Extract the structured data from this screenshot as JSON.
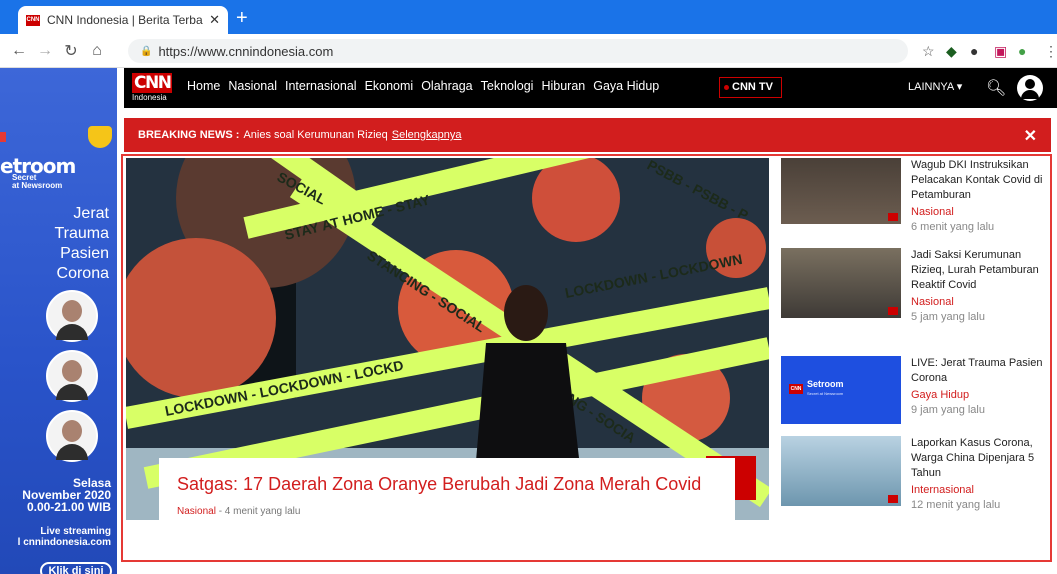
{
  "browser": {
    "tab_title": "CNN Indonesia | Berita Terbaru, T",
    "tab_favicon": "CNN",
    "url": "https://www.cnnindonesia.com"
  },
  "ad": {
    "brand": "etroom",
    "brand_sub_1": "Secret",
    "brand_sub_2": "at Newsroom",
    "headline_1": "Jerat",
    "headline_2": "Trauma",
    "headline_3": "Pasien",
    "headline_4": "Corona",
    "date_1": "Selasa",
    "date_2": "November 2020",
    "date_3": "0.00-21.00 WIB",
    "live_1": "Live streaming",
    "live_2": "l cnnindonesia.com",
    "cta": "Klik di sini"
  },
  "nav": {
    "logo": "CNN",
    "logo_sub": "Indonesia",
    "items": [
      "Home",
      "Nasional",
      "Internasional",
      "Ekonomi",
      "Olahraga",
      "Teknologi",
      "Hiburan",
      "Gaya Hidup"
    ],
    "cnntv": "CNN TV",
    "more": "LAINNYA ▾"
  },
  "breaking": {
    "label": "BREAKING NEWS :",
    "text": "Anies soal Kerumunan Rizieq",
    "link": "Selengkapnya"
  },
  "hero": {
    "headline": "Satgas: 17 Daerah Zona Oranye Berubah Jadi Zona Merah Covid",
    "category": "Nasional",
    "time": "- 4 menit yang lalu",
    "tape_1": "SOCIAL",
    "tape_2": "STAY AT HOME - STAY",
    "tape_3": "LOCKDOWN - LOCKDOWN",
    "tape_4": "LOCKDOWN - LOCKDOWN - LOCKD",
    "tape_5": "PSBB - PSBB - P",
    "tape_6": "STANCING - SOCIAL",
    "tape_7": "NCING - SOCIA"
  },
  "sidebar": [
    {
      "title": "Wagub DKI Instruksikan Pelacakan Kontak Covid di Petamburan",
      "category": "Nasional",
      "time": "6 menit yang lalu"
    },
    {
      "title": "Jadi Saksi Kerumunan Rizieq, Lurah Petamburan Reaktif Covid",
      "category": "Nasional",
      "time": "5 jam yang lalu"
    },
    {
      "title": "LIVE: Jerat Trauma Pasien Corona",
      "category": "Gaya Hidup",
      "time": "9 jam yang lalu"
    },
    {
      "title": "Laporkan Kasus Corona, Warga China Dipenjara 5 Tahun",
      "category": "Internasional",
      "time": "12 menit yang lalu"
    }
  ],
  "thumb3": {
    "badge": "CNN",
    "brand": "Setroom",
    "sub": "Secret at Newsroom"
  }
}
